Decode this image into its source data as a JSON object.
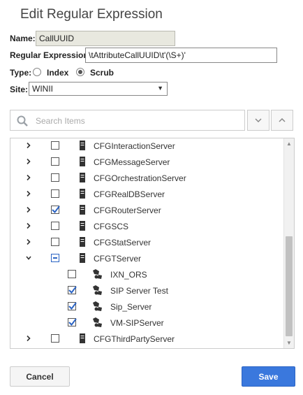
{
  "dialog": {
    "title": "Edit Regular Expression"
  },
  "form": {
    "name_label": "Name:",
    "name_value": "CallUUID",
    "regex_label": "Regular Expression:",
    "regex_value": "\\tAttributeCallUUID\\t'(\\S+)'",
    "type_label": "Type:",
    "type_options": [
      {
        "label": "Index",
        "checked": false
      },
      {
        "label": "Scrub",
        "checked": true
      }
    ],
    "site_label": "Site:",
    "site_value": "WINII"
  },
  "search": {
    "placeholder": "Search Items"
  },
  "tree": {
    "rows": [
      {
        "label": "CFGInteractionServer",
        "level": 0,
        "expander": "collapsed",
        "check": "unchecked",
        "icon": "server-icon"
      },
      {
        "label": "CFGMessageServer",
        "level": 0,
        "expander": "collapsed",
        "check": "unchecked",
        "icon": "server-icon"
      },
      {
        "label": "CFGOrchestrationServer",
        "level": 0,
        "expander": "collapsed",
        "check": "unchecked",
        "icon": "server-icon"
      },
      {
        "label": "CFGRealDBServer",
        "level": 0,
        "expander": "collapsed",
        "check": "unchecked",
        "icon": "server-icon"
      },
      {
        "label": "CFGRouterServer",
        "level": 0,
        "expander": "collapsed",
        "check": "checked",
        "icon": "server-icon"
      },
      {
        "label": "CFGSCS",
        "level": 0,
        "expander": "collapsed",
        "check": "unchecked",
        "icon": "server-icon"
      },
      {
        "label": "CFGStatServer",
        "level": 0,
        "expander": "collapsed",
        "check": "unchecked",
        "icon": "server-icon"
      },
      {
        "label": "CFGTServer",
        "level": 0,
        "expander": "expanded",
        "check": "partial",
        "icon": "server-icon"
      },
      {
        "label": "IXN_ORS",
        "level": 1,
        "expander": "none",
        "check": "unchecked",
        "icon": "application-icon"
      },
      {
        "label": "SIP Server Test",
        "level": 1,
        "expander": "none",
        "check": "checked",
        "icon": "application-icon"
      },
      {
        "label": "Sip_Server",
        "level": 1,
        "expander": "none",
        "check": "checked",
        "icon": "application-icon"
      },
      {
        "label": "VM-SIPServer",
        "level": 1,
        "expander": "none",
        "check": "checked",
        "icon": "application-icon"
      },
      {
        "label": "CFGThirdPartyServer",
        "level": 0,
        "expander": "collapsed",
        "check": "unchecked",
        "icon": "server-icon"
      }
    ]
  },
  "footer": {
    "cancel_label": "Cancel",
    "save_label": "Save"
  },
  "colors": {
    "accent": "#3a78dd",
    "check": "#2a63c4",
    "readonly_bg": "#e8e8df"
  }
}
